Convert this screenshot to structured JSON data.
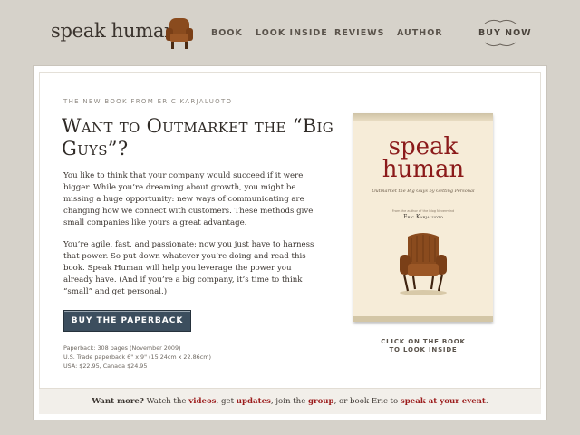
{
  "header": {
    "logo": "speak human",
    "nav": [
      "BOOK",
      "LOOK INSIDE",
      "REVIEWS",
      "AUTHOR"
    ],
    "buy_now": "BUY NOW"
  },
  "main": {
    "kicker": "THE NEW BOOK FROM ERIC KARJALUOTO",
    "headline": "Want to Outmarket the “Big Guys”?",
    "para1": "You like to think that your company would succeed if it were bigger. While you’re dreaming about growth, you might be missing a huge opportunity: new ways of communicating are changing how we connect with customers. These methods give small companies like yours a great advantage.",
    "para2": "You’re agile, fast, and passionate; now you just have to harness that power. So put down whatever you’re doing and read this book. Speak Human will help you leverage the power you already have. (And if you’re a big company, it’s time to think “small” and get personal.)",
    "buy_button": "BUY THE PAPERBACK",
    "specs": [
      "Paperback: 308 pages (November 2009)",
      "U.S. Trade paperback 6\" x 9\" (15.24cm x 22.86cm)",
      "USA: $22.95, Canada $24.95"
    ]
  },
  "book": {
    "title_line1": "speak",
    "title_line2": "human",
    "subtitle": "Outmarket the Big Guys by Getting Personal",
    "from_line": "From the author of the blog Nevermind",
    "author": "Eric Karjaluoto",
    "caption_line1": "CLICK ON THE BOOK",
    "caption_line2": "TO LOOK INSIDE"
  },
  "footer": {
    "want_more": "Want more?",
    "t1": " Watch the ",
    "videos": "videos",
    "t2": ", get ",
    "updates": "updates",
    "t3": ", join the ",
    "group": "group",
    "t4": ", or book Eric to ",
    "speak": "speak at your event",
    "t5": "."
  },
  "colors": {
    "background": "#d6d2ca",
    "button": "#3c4e5e",
    "accent_red": "#8b1a1a"
  }
}
